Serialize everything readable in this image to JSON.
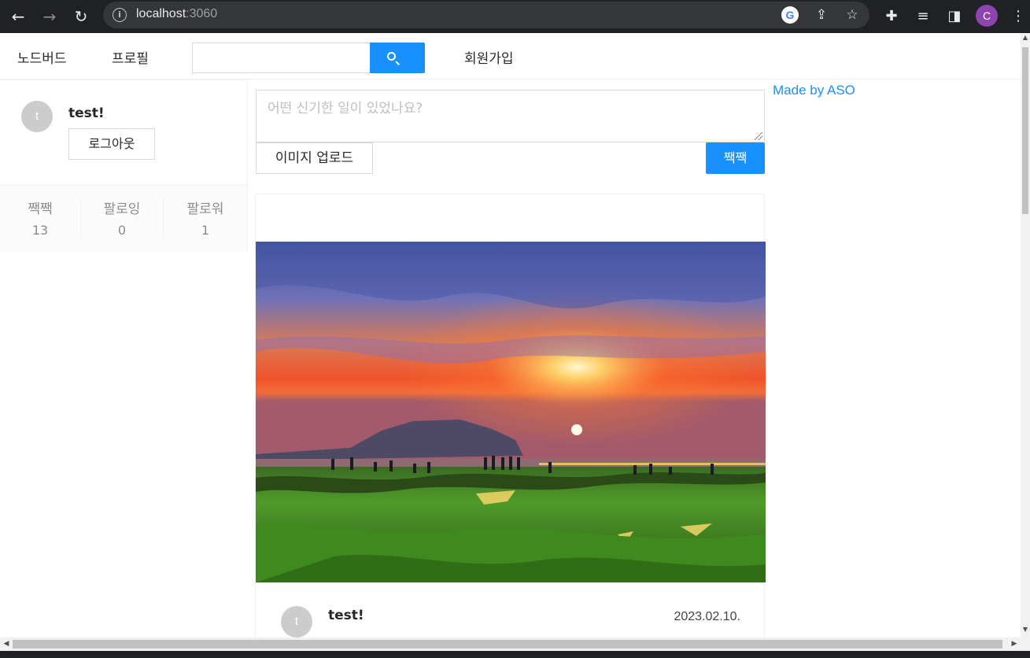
{
  "browser": {
    "url_host": "localhost",
    "url_port": ":3060",
    "profile_initial": "C"
  },
  "menu": {
    "home": "노드버드",
    "profile": "프로필",
    "signup": "회원가입",
    "search_value": ""
  },
  "user_card": {
    "avatar_initial": "t",
    "nickname": "test!",
    "logout_label": "로그아웃",
    "stats": [
      {
        "label": "짹짹",
        "value": "13"
      },
      {
        "label": "팔로잉",
        "value": "0"
      },
      {
        "label": "팔로워",
        "value": "1"
      }
    ]
  },
  "post_form": {
    "placeholder": "어떤 신기한 일이 있었나요?",
    "upload_label": "이미지 업로드",
    "submit_label": "짹짹"
  },
  "post": {
    "author_initial": "t",
    "author": "test!",
    "date": "2023.02.10."
  },
  "footer_link": "Made by ASO",
  "colors": {
    "primary": "#1890ff",
    "chrome_bg": "#202124",
    "avatar_bg": "#cccccc"
  }
}
